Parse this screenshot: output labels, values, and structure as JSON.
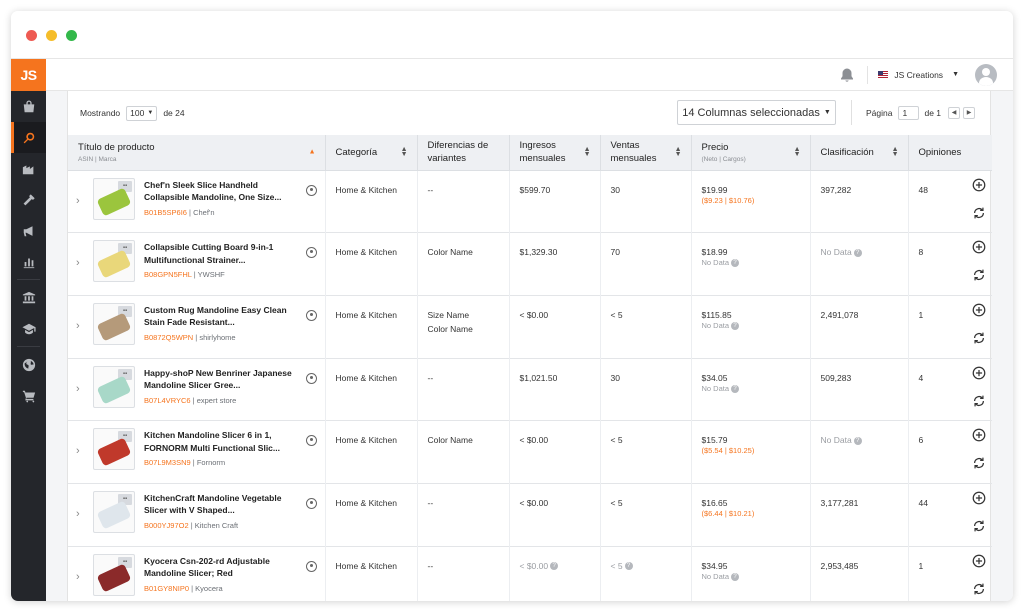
{
  "app": {
    "logo": "JS",
    "account_name": "JS Creations"
  },
  "sidebar": {
    "items": [
      {
        "icon": "store-icon",
        "active": false
      },
      {
        "icon": "product-search-icon",
        "active": true
      },
      {
        "icon": "supplier-icon",
        "active": false
      },
      {
        "icon": "tools-icon",
        "active": false
      },
      {
        "icon": "megaphone-icon",
        "active": false
      },
      {
        "icon": "analytics-icon",
        "active": false
      },
      {
        "icon": "academy-icon",
        "active": false
      },
      {
        "icon": "graduation-icon",
        "active": false
      },
      {
        "icon": "globe-icon",
        "active": false
      },
      {
        "icon": "cart-icon",
        "active": false
      }
    ]
  },
  "toolbar": {
    "showing_label": "Mostrando",
    "showing_value": "100",
    "of_label": "de 24",
    "columns_button": "14 Columnas seleccionadas",
    "page_label": "Página",
    "page_value": "1",
    "page_total": "de 1"
  },
  "columns": {
    "product": "Título de producto",
    "product_sub": "ASIN | Marca",
    "category": "Categoría",
    "variants": "Diferencias de variantes",
    "revenue": "Ingresos mensuales",
    "sales": "Ventas mensuales",
    "price": "Precio",
    "price_sub": "(Neto | Cargos)",
    "rank": "Clasificación",
    "reviews": "Opiniones"
  },
  "rows": [
    {
      "title": "Chef'n Sleek Slice Handheld Collapsible Mandoline, One Size...",
      "asin": "B01B5SP6I6",
      "brand": "Chef'n",
      "category": "Home & Kitchen",
      "variants": "--",
      "variants2": "",
      "revenue": "$599.70",
      "revenue_na": false,
      "sales": "30",
      "sales_na": false,
      "price": "$19.99",
      "fees": "($9.23 | $10.76)",
      "rank": "397,282",
      "rank_na": false,
      "reviews": "48",
      "thumb_color": "#9bc53d"
    },
    {
      "title": "Collapsible Cutting Board 9-in-1 Multifunctional Strainer...",
      "asin": "B08GPN5FHL",
      "brand": "YWSHF",
      "category": "Home & Kitchen",
      "variants": "Color Name",
      "variants2": "",
      "revenue": "$1,329.30",
      "revenue_na": false,
      "sales": "70",
      "sales_na": false,
      "price": "$18.99",
      "fees": "No Data",
      "rank": "No Data",
      "rank_na": true,
      "reviews": "8",
      "thumb_color": "#e9d77a"
    },
    {
      "title": "Custom Rug Mandoline Easy Clean Stain Fade Resistant...",
      "asin": "B0872Q5WPN",
      "brand": "shirlyhome",
      "category": "Home & Kitchen",
      "variants": "Size Name",
      "variants2": "Color Name",
      "revenue": "< $0.00",
      "revenue_na": false,
      "sales": "< 5",
      "sales_na": false,
      "price": "$115.85",
      "fees": "No Data",
      "rank": "2,491,078",
      "rank_na": false,
      "reviews": "1",
      "thumb_color": "#b59a7a"
    },
    {
      "title": "Happy-shoP New Benriner Japanese Mandoline Slicer Gree...",
      "asin": "B07L4VRYC6",
      "brand": "expert store",
      "category": "Home & Kitchen",
      "variants": "--",
      "variants2": "",
      "revenue": "$1,021.50",
      "revenue_na": false,
      "sales": "30",
      "sales_na": false,
      "price": "$34.05",
      "fees": "No Data",
      "rank": "509,283",
      "rank_na": false,
      "reviews": "4",
      "thumb_color": "#a8d8c8"
    },
    {
      "title": "Kitchen Mandoline Slicer 6 in 1, FORNORM Multi Functional Slic...",
      "asin": "B07L9M3SN9",
      "brand": "Fornorm",
      "category": "Home & Kitchen",
      "variants": "Color Name",
      "variants2": "",
      "revenue": "< $0.00",
      "revenue_na": false,
      "sales": "< 5",
      "sales_na": false,
      "price": "$15.79",
      "fees": "($5.54 | $10.25)",
      "rank": "No Data",
      "rank_na": true,
      "reviews": "6",
      "thumb_color": "#c0392b"
    },
    {
      "title": "KitchenCraft Mandoline Vegetable Slicer with V Shaped...",
      "asin": "B000YJ97O2",
      "brand": "Kitchen Craft",
      "category": "Home & Kitchen",
      "variants": "--",
      "variants2": "",
      "revenue": "< $0.00",
      "revenue_na": false,
      "sales": "< 5",
      "sales_na": false,
      "price": "$16.65",
      "fees": "($6.44 | $10.21)",
      "rank": "3,177,281",
      "rank_na": false,
      "reviews": "44",
      "thumb_color": "#dfe6ec"
    },
    {
      "title": "Kyocera Csn-202-rd Adjustable Mandoline Slicer; Red",
      "asin": "B01GY8NIP0",
      "brand": "Kyocera",
      "category": "Home & Kitchen",
      "variants": "--",
      "variants2": "",
      "revenue": "< $0.00",
      "revenue_na": true,
      "sales": "< 5",
      "sales_na": true,
      "price": "$34.95",
      "fees": "No Data",
      "rank": "2,953,485",
      "rank_na": false,
      "reviews": "1",
      "thumb_color": "#8b2a2a"
    }
  ],
  "colors": {
    "accent": "#f5741e",
    "sidebar_bg": "#24262b"
  }
}
